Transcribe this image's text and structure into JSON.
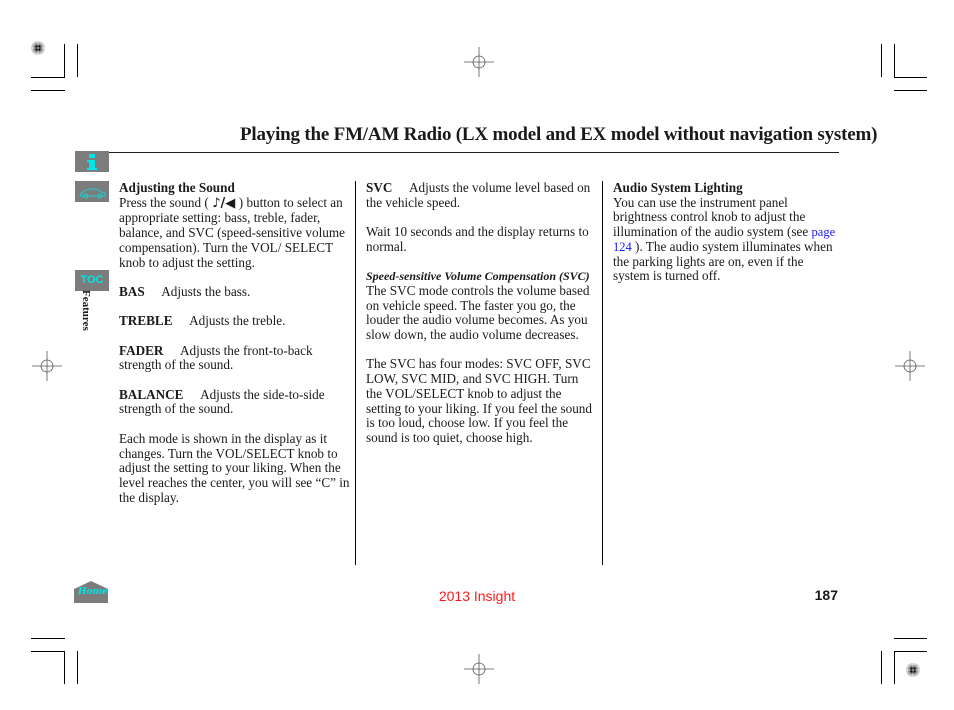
{
  "header": {
    "title": "Playing the FM/AM Radio (LX model and EX model without navigation system)"
  },
  "sidebar": {
    "info_icon": "info-icon",
    "car_icon": "car-icon",
    "toc_label": "TOC",
    "section_label": "Features",
    "home_label": "Home"
  },
  "column1": {
    "heading": "Adjusting the Sound",
    "intro_before_icon": "Press the sound (",
    "sound_icon": "music-mute-icon",
    "sound_icon_glyph": "♪/◀",
    "intro_after_icon": ") button to select an appropriate setting: bass, treble, fader, balance, and SVC (speed-sensitive volume compensation). Turn the VOL/ SELECT knob to adjust the setting.",
    "items": [
      {
        "term": "BAS",
        "desc": "Adjusts the bass."
      },
      {
        "term": "TREBLE",
        "desc": "Adjusts the treble."
      },
      {
        "term": "FADER",
        "desc": "Adjusts the front-to-back strength of the sound."
      },
      {
        "term": "BALANCE",
        "desc": "Adjusts the side-to-side strength of the sound."
      }
    ],
    "closing": "Each mode is shown in the display as it changes. Turn the VOL/SELECT knob to adjust the setting to your liking. When the level reaches the center, you will see “C” in the display."
  },
  "column2": {
    "svc_term": "SVC",
    "svc_desc": "Adjusts the volume level based on the vehicle speed.",
    "wait_text": "Wait 10 seconds and the display returns to normal.",
    "subheading": "Speed-sensitive Volume Compensation (SVC)",
    "para1": "The SVC mode controls the volume based on vehicle speed. The faster you go, the louder the audio volume becomes. As you slow down, the audio volume decreases.",
    "para2": "The SVC has four modes: SVC OFF, SVC LOW, SVC MID, and SVC HIGH. Turn the VOL/SELECT knob to adjust the setting to your liking. If you feel the sound is too loud, choose low. If you feel the sound is too quiet, choose high."
  },
  "column3": {
    "heading": "Audio System Lighting",
    "text_before_link": "You can use the instrument panel brightness control knob to adjust the illumination of the audio system (see ",
    "link_text": "page 124",
    "text_after_link": " ). The audio system illuminates when the parking lights are on, even if the system is turned off."
  },
  "footer": {
    "model": "2013 Insight",
    "page_number": "187"
  },
  "colors": {
    "footer_model": "#ff1a1a",
    "link": "#1a1aff",
    "sidebar_box": "#7c7c7c",
    "sidebar_accent": "#00e5e5"
  }
}
